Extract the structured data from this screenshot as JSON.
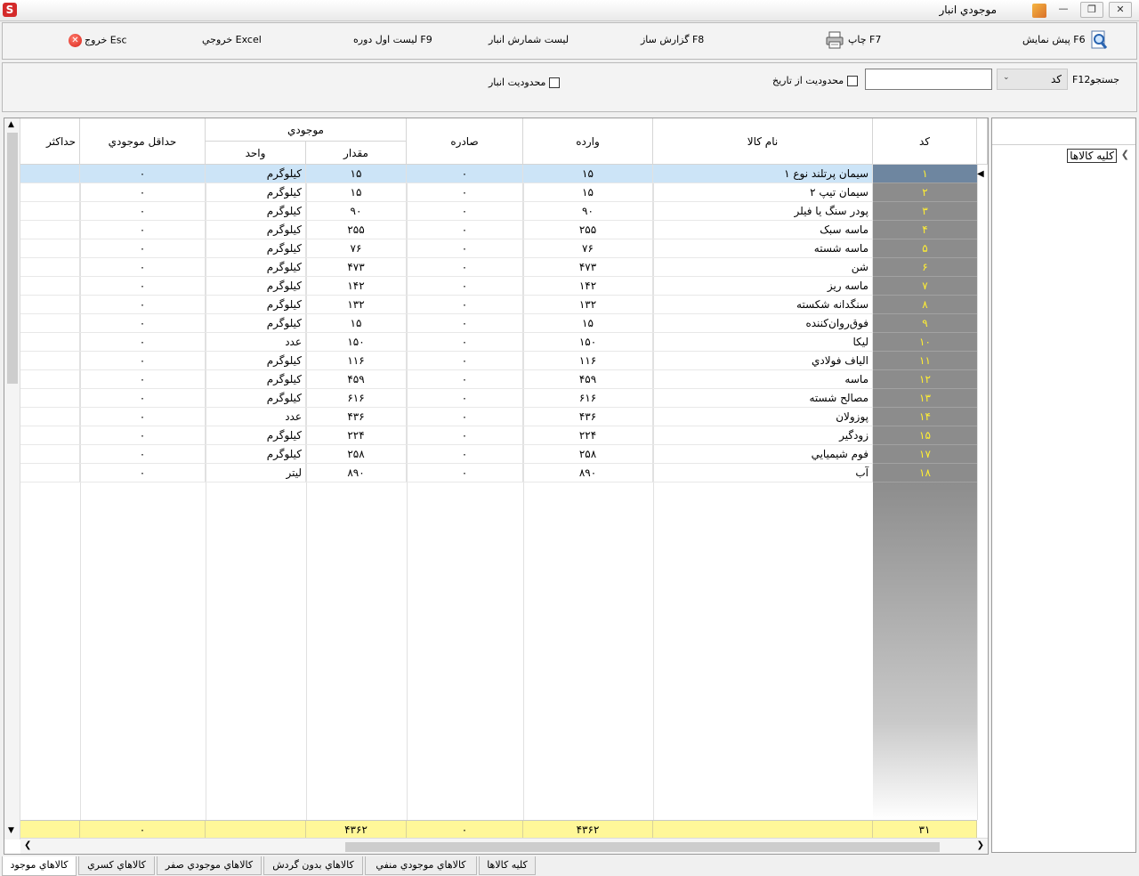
{
  "window": {
    "title": "موجودي انبار",
    "app_icon": "S"
  },
  "toolbar": {
    "exit": "خروج Esc",
    "excel": "خروجي Excel",
    "opening_list": "ليست اول دوره F9",
    "count_list": "ليست شمارش انبار",
    "report_builder": "گزارش ساز F8",
    "print": "چاپ F7",
    "preview": "پيش نمايش F6"
  },
  "filter": {
    "warehouse_limit": "محدوديت انبار",
    "date_limit": "محدوديت از تاريخ",
    "search_value": "",
    "search_field": "کد",
    "search_label": "F12جستجو"
  },
  "grid": {
    "headers": {
      "code": "کد",
      "name": "نام کالا",
      "incoming": "وارده",
      "outgoing": "صادره",
      "stock": "موجودي",
      "quantity": "مقدار",
      "unit": "واحد",
      "min_stock": "حداقل موجودي",
      "max_stock": "حداکثر"
    },
    "rows": [
      {
        "code": "۱",
        "name": "سيمان پرتلند نوع ۱",
        "incoming": "۱۵",
        "outgoing": "۰",
        "quantity": "۱۵",
        "unit": "کيلوگرم",
        "min": "۰"
      },
      {
        "code": "۲",
        "name": "سيمان تيپ ۲",
        "incoming": "۱۵",
        "outgoing": "۰",
        "quantity": "۱۵",
        "unit": "کيلوگرم",
        "min": "۰"
      },
      {
        "code": "۳",
        "name": "پودر سنگ يا فيلر",
        "incoming": "۹۰",
        "outgoing": "۰",
        "quantity": "۹۰",
        "unit": "کيلوگرم",
        "min": "۰"
      },
      {
        "code": "۴",
        "name": "ماسه سبک",
        "incoming": "۲۵۵",
        "outgoing": "۰",
        "quantity": "۲۵۵",
        "unit": "کيلوگرم",
        "min": "۰"
      },
      {
        "code": "۵",
        "name": "ماسه شسته",
        "incoming": "۷۶",
        "outgoing": "۰",
        "quantity": "۷۶",
        "unit": "کيلوگرم",
        "min": "۰"
      },
      {
        "code": "۶",
        "name": "شن",
        "incoming": "۴۷۳",
        "outgoing": "۰",
        "quantity": "۴۷۳",
        "unit": "کيلوگرم",
        "min": "۰"
      },
      {
        "code": "۷",
        "name": "ماسه ريز",
        "incoming": "۱۴۲",
        "outgoing": "۰",
        "quantity": "۱۴۲",
        "unit": "کيلوگرم",
        "min": "۰"
      },
      {
        "code": "۸",
        "name": "سنگدانه شکسته",
        "incoming": "۱۳۲",
        "outgoing": "۰",
        "quantity": "۱۳۲",
        "unit": "کيلوگرم",
        "min": "۰"
      },
      {
        "code": "۹",
        "name": "فوق‌روان‌کننده",
        "incoming": "۱۵",
        "outgoing": "۰",
        "quantity": "۱۵",
        "unit": "کيلوگرم",
        "min": "۰"
      },
      {
        "code": "۱۰",
        "name": "ليکا",
        "incoming": "۱۵۰",
        "outgoing": "۰",
        "quantity": "۱۵۰",
        "unit": "عدد",
        "min": "۰"
      },
      {
        "code": "۱۱",
        "name": "الياف فولادي",
        "incoming": "۱۱۶",
        "outgoing": "۰",
        "quantity": "۱۱۶",
        "unit": "کيلوگرم",
        "min": "۰"
      },
      {
        "code": "۱۲",
        "name": "ماسه",
        "incoming": "۴۵۹",
        "outgoing": "۰",
        "quantity": "۴۵۹",
        "unit": "کيلوگرم",
        "min": "۰"
      },
      {
        "code": "۱۳",
        "name": "مصالح شسته",
        "incoming": "۶۱۶",
        "outgoing": "۰",
        "quantity": "۶۱۶",
        "unit": "کيلوگرم",
        "min": "۰"
      },
      {
        "code": "۱۴",
        "name": "پوزولان",
        "incoming": "۴۳۶",
        "outgoing": "۰",
        "quantity": "۴۳۶",
        "unit": "عدد",
        "min": "۰"
      },
      {
        "code": "۱۵",
        "name": "زودگير",
        "incoming": "۲۲۴",
        "outgoing": "۰",
        "quantity": "۲۲۴",
        "unit": "کيلوگرم",
        "min": "۰"
      },
      {
        "code": "۱۷",
        "name": "فوم شيميايي",
        "incoming": "۲۵۸",
        "outgoing": "۰",
        "quantity": "۲۵۸",
        "unit": "کيلوگرم",
        "min": "۰"
      },
      {
        "code": "۱۸",
        "name": "آب",
        "incoming": "۸۹۰",
        "outgoing": "۰",
        "quantity": "۸۹۰",
        "unit": "ليتر",
        "min": "۰"
      }
    ],
    "footer": {
      "code": "۳۱",
      "incoming": "۴۳۶۲",
      "outgoing": "۰",
      "quantity": "۴۳۶۲",
      "min": "۰"
    },
    "selected_row": 1
  },
  "tree": {
    "root": "کليه کالاها"
  },
  "tabs": [
    "کالاهاي موجود",
    "کالاهاي کسري",
    "کالاهاي موجودي صفر",
    "کالاهاي بدون گردش",
    "کالاهاي موجودي منفي",
    "کليه کالاها"
  ],
  "colors": {
    "code_text": "#ffee33",
    "footer_bg": "#fff799",
    "selection": "#cce4f7"
  }
}
